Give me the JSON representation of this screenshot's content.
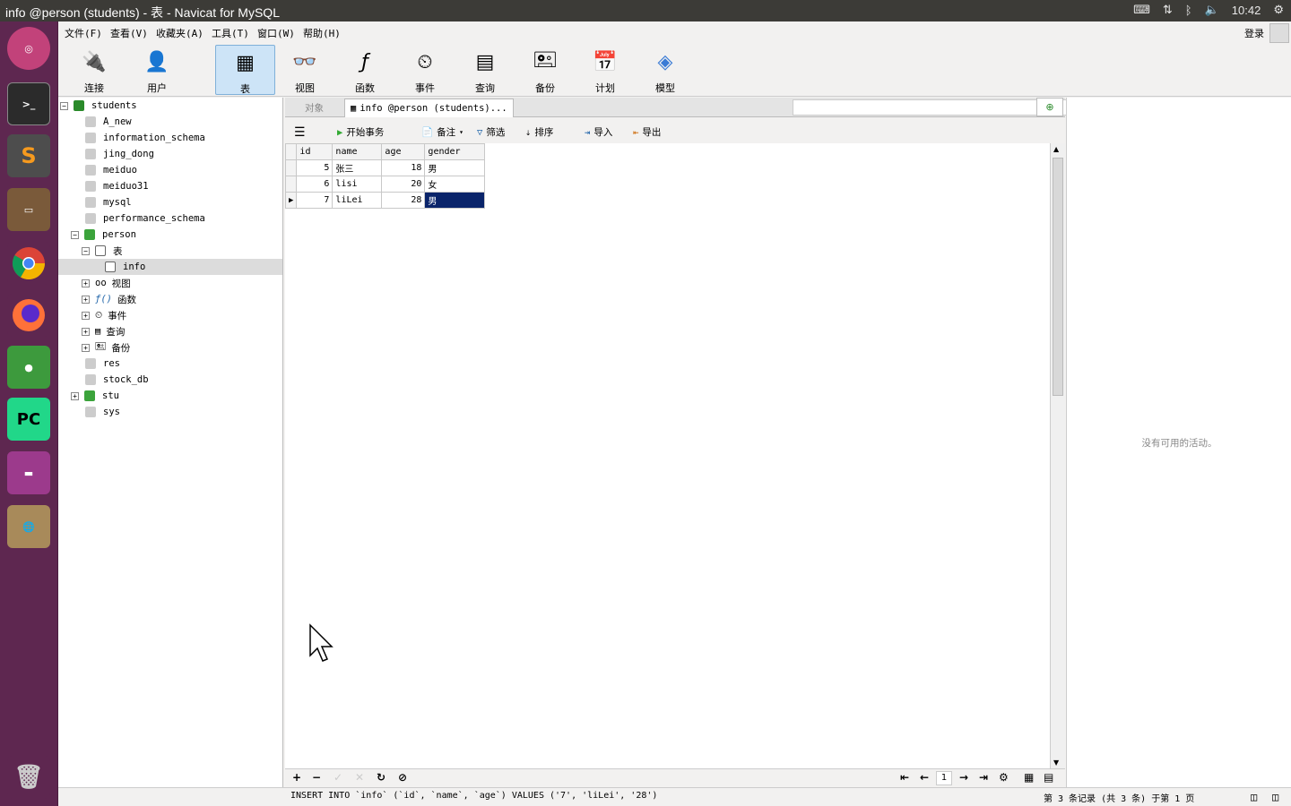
{
  "window": {
    "title": "info @person (students) - 表 - Navicat for MySQL"
  },
  "tray": {
    "keyboard_icon": "keyboard-icon",
    "network_icon": "network-icon",
    "bluetooth_icon": "bluetooth-icon",
    "volume_icon": "volume-icon",
    "time": "10:42",
    "gear_icon": "gear-icon"
  },
  "launcher": {
    "items": [
      "ubuntu-home",
      "terminal",
      "sublime-text",
      "file-manager",
      "chrome",
      "firefox",
      "green-app",
      "pycharm",
      "purple-app",
      "archive-globe",
      "trash"
    ]
  },
  "menubar": {
    "items": [
      "文件(F)",
      "查看(V)",
      "收藏夹(A)",
      "工具(T)",
      "窗口(W)",
      "帮助(H)"
    ],
    "login": "登录"
  },
  "toolbar": {
    "items": [
      {
        "label": "连接",
        "icon": "plug-icon"
      },
      {
        "label": "用户",
        "icon": "user-icon"
      },
      {
        "label": "表",
        "icon": "table-icon",
        "active": true
      },
      {
        "label": "视图",
        "icon": "view-icon"
      },
      {
        "label": "函数",
        "icon": "function-icon"
      },
      {
        "label": "事件",
        "icon": "event-icon"
      },
      {
        "label": "查询",
        "icon": "query-icon"
      },
      {
        "label": "备份",
        "icon": "backup-icon"
      },
      {
        "label": "计划",
        "icon": "schedule-icon"
      },
      {
        "label": "模型",
        "icon": "model-icon"
      }
    ]
  },
  "tree": {
    "connection": "students",
    "databases": [
      "A_new",
      "information_schema",
      "jing_dong",
      "meiduo",
      "meiduo31",
      "mysql",
      "performance_schema",
      "person"
    ],
    "person_children": {
      "tables_label": "表",
      "table": "info",
      "views": "视图",
      "functions": "函数",
      "events": "事件",
      "queries": "查询",
      "backups": "备份"
    },
    "databases_after": [
      "res",
      "stock_db",
      "stu",
      "sys"
    ]
  },
  "tabs": {
    "objects": "对象",
    "active": "info @person (students)..."
  },
  "subtoolbar": {
    "menu_icon": "menu-icon",
    "begin_tx": "开始事务",
    "memo": "备注",
    "filter": "筛选",
    "sort": "排序",
    "import": "导入",
    "export": "导出"
  },
  "grid": {
    "columns": [
      "id",
      "name",
      "age",
      "gender"
    ],
    "rows": [
      [
        "5",
        "张三",
        "18",
        "男"
      ],
      [
        "6",
        "lisi",
        "20",
        "女"
      ],
      [
        "7",
        "liLei",
        "28",
        "男"
      ]
    ]
  },
  "bottombar": {
    "page": "1"
  },
  "rightpanel": {
    "message": "没有可用的活动。"
  },
  "status": {
    "sql": "INSERT INTO `info` (`id`, `name`, `age`) VALUES ('7', 'liLei', '28')",
    "records": "第 3 条记录 (共 3 条) 于第 1 页"
  }
}
